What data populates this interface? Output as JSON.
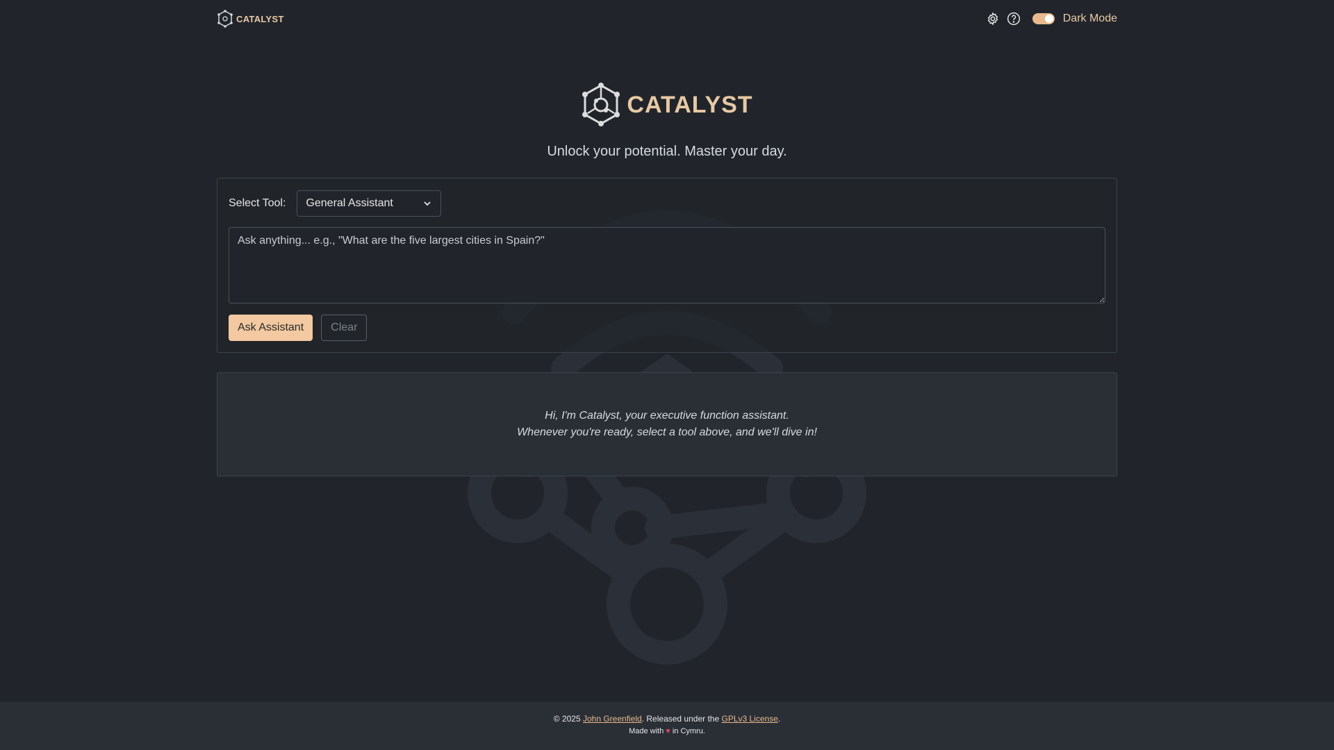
{
  "header": {
    "brand": "CATALYST",
    "settings_icon": "gear-icon",
    "help_icon": "help-circle-icon",
    "theme_toggle": {
      "label": "Dark Mode",
      "checked": true
    }
  },
  "hero": {
    "brand": "CATALYST",
    "tagline": "Unlock your potential. Master your day."
  },
  "tool_form": {
    "select_label": "Select Tool:",
    "selected_tool": "General Assistant",
    "prompt_placeholder": "Ask anything... e.g., \"What are the five largest cities in Spain?\"",
    "prompt_value": "",
    "ask_label": "Ask Assistant",
    "clear_label": "Clear"
  },
  "output": {
    "line1": "Hi, I'm Catalyst, your executive function assistant.",
    "line2": "Whenever you're ready, select a tool above, and we'll dive in!"
  },
  "footer": {
    "copyright": "© 2025",
    "author": "John Greenfield",
    "released": ". Released under the",
    "license": "GPLv3 License",
    "period": ".",
    "made_with": "Made with",
    "heart": "♥",
    "location": "in Cymru."
  },
  "colors": {
    "background": "#21252b",
    "accent": "#e8c9a3",
    "button": "#f2c9a0",
    "panel": "#2a2f36"
  }
}
